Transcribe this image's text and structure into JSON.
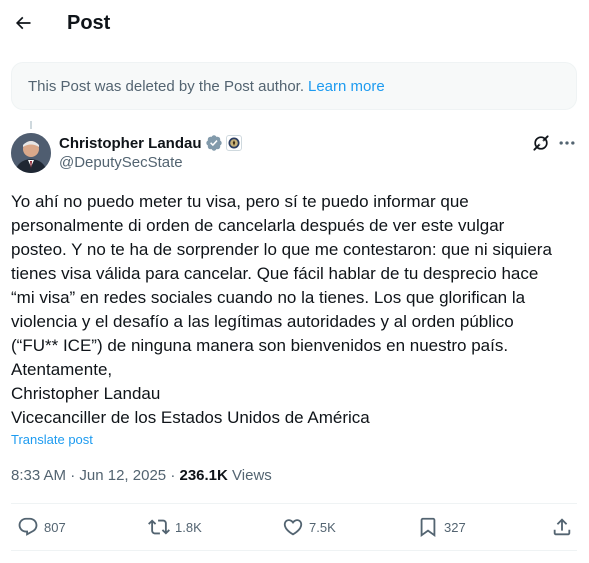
{
  "header": {
    "title": "Post"
  },
  "notice": {
    "text": "This Post was deleted by the Post author.",
    "link": "Learn more"
  },
  "author": {
    "name": "Christopher Landau",
    "handle": "@DeputySecState"
  },
  "tweet": {
    "lines": [
      "Yo ahí no puedo meter tu visa, pero sí te puedo informar que",
      "personalmente di orden de cancelarla después de ver este vulgar",
      "posteo. Y no te ha de sorprender lo que me contestaron: que ni siquiera",
      "tienes visa válida para cancelar. Que fácil hablar de tu desprecio hace",
      "“mi visa” en redes sociales cuando no la tienes. Los que glorifican la",
      "violencia y el desafío a las legítimas autoridades y al orden público",
      "(“FU** ICE”) de ninguna manera son bienvenidos en nuestro país.",
      "Atentamente,",
      "Christopher Landau",
      "Vicecanciller de los Estados Unidos de América"
    ],
    "translate": "Translate post"
  },
  "meta": {
    "time": "8:33 AM",
    "date": "Jun 12, 2025",
    "views_count": "236.1K",
    "views_label": "Views"
  },
  "actions": {
    "replies": "807",
    "reposts": "1.8K",
    "likes": "7.5K",
    "bookmarks": "327"
  },
  "colors": {
    "accent": "#1d9bf0",
    "secondary_text": "#536471",
    "text": "#0f1419"
  }
}
